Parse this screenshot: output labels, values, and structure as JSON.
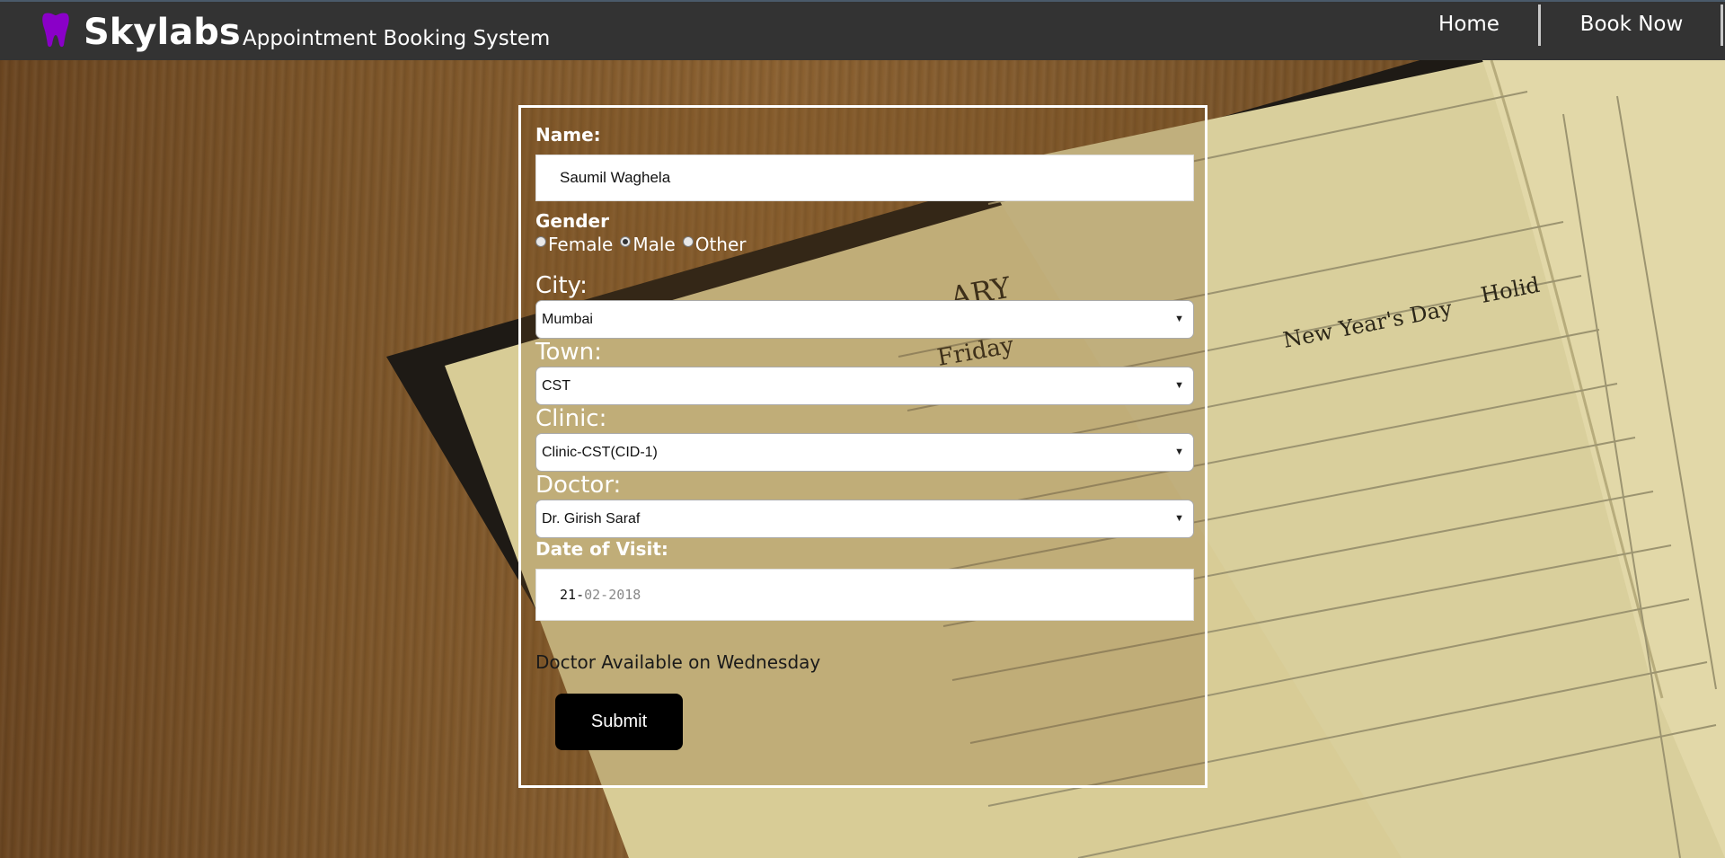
{
  "navbar": {
    "brand": "Skylabs",
    "tagline": "Appointment Booking System",
    "links": [
      {
        "label": "Home"
      },
      {
        "label": "Book Now"
      }
    ],
    "brand_icon": "tooth-icon",
    "brand_icon_color": "#8a00c8",
    "background": "#333333"
  },
  "form": {
    "name_label": "Name:",
    "name_value": "Saumil Waghela",
    "gender_label": "Gender",
    "gender_options": [
      "Female",
      "Male",
      "Other"
    ],
    "gender_selected": "Male",
    "city_label": "City:",
    "city_value": "Mumbai",
    "town_label": "Town:",
    "town_value": "CST",
    "clinic_label": "Clinic:",
    "clinic_value": "Clinic-CST(CID-1)",
    "doctor_label": "Doctor:",
    "doctor_value": "Dr. Girish Saraf",
    "date_label": "Date of Visit:",
    "date_day": "21",
    "date_month": "02",
    "date_year": "2018",
    "availability": "Doctor Available on Wednesday",
    "submit_label": "Submit"
  },
  "background_scene": {
    "diary_text_1": "ARY",
    "diary_text_2": "Friday",
    "diary_text_3": "New Year's Day",
    "diary_text_4": "Holid"
  }
}
